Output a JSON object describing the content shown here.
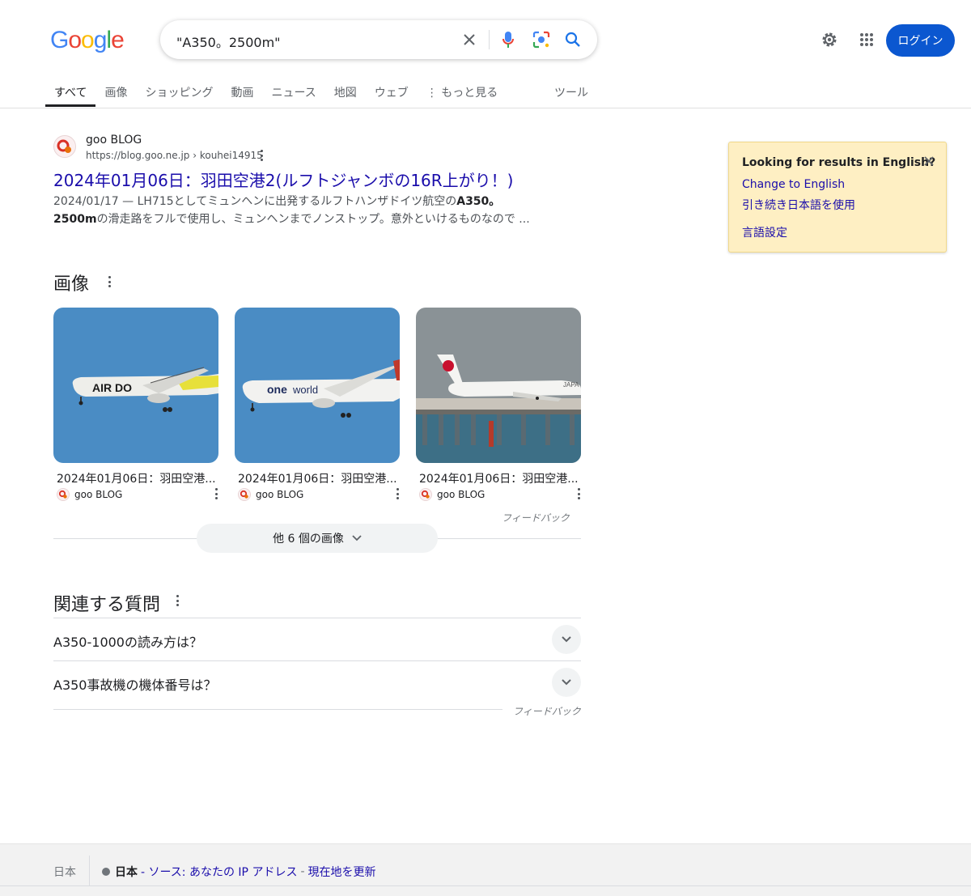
{
  "header": {
    "logo_letters": [
      {
        "ch": "G",
        "color": "#4285F4"
      },
      {
        "ch": "o",
        "color": "#EA4335"
      },
      {
        "ch": "o",
        "color": "#FBBC05"
      },
      {
        "ch": "g",
        "color": "#4285F4"
      },
      {
        "ch": "l",
        "color": "#34A853"
      },
      {
        "ch": "e",
        "color": "#EA4335"
      }
    ],
    "search_query": "\"A350。2500m\"",
    "clear_icon": "close-icon",
    "voice_icon": "microphone-icon",
    "lens_icon": "camera-lens-icon",
    "search_icon": "search-icon",
    "settings_icon": "gear-icon",
    "apps_icon": "apps-grid-icon",
    "login_label": "ログイン"
  },
  "tabs": [
    {
      "label": "すべて",
      "active": true
    },
    {
      "label": "画像",
      "active": false
    },
    {
      "label": "ショッピング",
      "active": false
    },
    {
      "label": "動画",
      "active": false
    },
    {
      "label": "ニュース",
      "active": false
    },
    {
      "label": "地図",
      "active": false
    },
    {
      "label": "ウェブ",
      "active": false
    },
    {
      "label": "⋮ もっと見る",
      "active": false
    }
  ],
  "tools_label": "ツール",
  "result": {
    "site_name": "goo BLOG",
    "url": "https://blog.goo.ne.jp › kouhei14915",
    "title": "2024年01月06日：羽田空港2(ルフトジャンボの16R上がり！)",
    "date": "2024/01/17",
    "snippet_pre": " — LH715としてミュンヘンに出発するルフトハンザドイツ航空の",
    "snippet_bold": "A350。2500m",
    "snippet_post": "の滑走路をフルで使用し、ミュンヘンまでノンストップ。意外といけるものなので ..."
  },
  "images_section": {
    "title": "画像",
    "items": [
      {
        "caption": "2024年01月06日：羽田空港...",
        "source": "goo BLOG",
        "image": "airdo-plane"
      },
      {
        "caption": "2024年01月06日：羽田空港...",
        "source": "goo BLOG",
        "image": "oneworld-plane"
      },
      {
        "caption": "2024年01月06日：羽田空港...",
        "source": "goo BLOG",
        "image": "jal-plane"
      }
    ],
    "feedback": "フィードバック",
    "more_label": "他 6 個の画像"
  },
  "paa": {
    "title": "関連する質問",
    "questions": [
      "A350-1000の読み方は？",
      "A350事故機の機体番号は？"
    ],
    "feedback": "フィードバック"
  },
  "lang_card": {
    "title": "Looking for results in English?",
    "change_link": "Change to English",
    "keep_link": "引き続き日本語を使用",
    "settings_link": "言語設定"
  },
  "footer": {
    "country": "日本",
    "location_bold": "日本",
    "source_text": " - ソース: あなたの IP アドレス",
    "update_link": "現在地を更新"
  },
  "colors": {
    "link": "#1a0dab",
    "accent": "#0b57d0",
    "card_bg": "#feefc3"
  }
}
